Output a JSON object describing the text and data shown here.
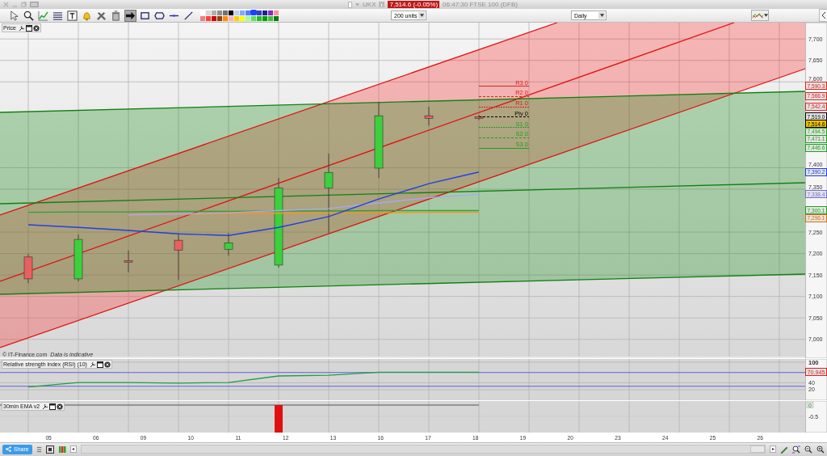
{
  "title_bar": {
    "symbol": "UKX",
    "price_badge": "7,514.6 (-0.05%)",
    "status": "06:47:30 FTSE 100 (DFB)"
  },
  "toolbar": {
    "tools": [
      {
        "kind": "pointer",
        "selected": false
      },
      {
        "kind": "zoom",
        "selected": false
      },
      {
        "kind": "chart-line",
        "selected": false
      },
      {
        "kind": "text-lines",
        "selected": false
      },
      {
        "kind": "text-box",
        "selected": false
      },
      {
        "kind": "bell",
        "selected": false
      },
      {
        "kind": "tools",
        "selected": false
      },
      {
        "kind": "trash",
        "selected": false
      },
      {
        "kind": "arrow",
        "selected": true
      },
      {
        "kind": "rectangle",
        "selected": false
      },
      {
        "kind": "ellipse",
        "selected": false
      },
      {
        "kind": "horizontal-line",
        "selected": false
      },
      {
        "kind": "trend-line",
        "selected": false
      }
    ],
    "palette": [
      {
        "color": "#ffffff",
        "selected": false
      },
      {
        "color": "#d8d8d8",
        "selected": false
      },
      {
        "color": "#b0b0b0",
        "selected": false
      },
      {
        "color": "#909090",
        "selected": false
      },
      {
        "color": "#707070",
        "selected": false
      },
      {
        "color": "#000000",
        "selected": false
      },
      {
        "color": "#b8d0ff",
        "selected": false
      },
      {
        "color": "#80a8ff",
        "selected": false
      },
      {
        "color": "#5080ff",
        "selected": false
      },
      {
        "color": "#2040ff",
        "selected": true
      },
      {
        "color": "#3040c0",
        "selected": false
      },
      {
        "color": "#202090",
        "selected": false
      },
      {
        "color": "#8030c0",
        "selected": false
      },
      {
        "color": "#ff90a0",
        "selected": false
      },
      {
        "color": "#f08080",
        "selected": false
      },
      {
        "color": "#ff4040",
        "selected": false
      },
      {
        "color": "#d00000",
        "selected": false
      },
      {
        "color": "#8b4513",
        "selected": false
      },
      {
        "color": "#ff8c00",
        "selected": false
      },
      {
        "color": "#ffb0b0",
        "selected": false
      },
      {
        "color": "#ffd000",
        "selected": false
      },
      {
        "color": "#ffff00",
        "selected": false
      },
      {
        "color": "#a0ffa0",
        "selected": false
      },
      {
        "color": "#60e060",
        "selected": false
      },
      {
        "color": "#20c020",
        "selected": false
      },
      {
        "color": "#00a000",
        "selected": false
      },
      {
        "color": "#40c040",
        "selected": false
      },
      {
        "color": "#008000",
        "selected": false
      }
    ],
    "units": "200 units",
    "period": "Daily"
  },
  "price_pane": {
    "title": "Price",
    "copyright": "© IT-Finance.com",
    "disclaimer": "Data is indicative",
    "axis_labels": [
      "7,700",
      "7,650",
      "7,600",
      "7,400",
      "7,350",
      "7,250",
      "7,200",
      "7,150",
      "7,100",
      "7,050",
      "7,000"
    ],
    "pivot_labels": [
      {
        "label": "R3 0",
        "color": "#e02020"
      },
      {
        "label": "R2 0",
        "color": "#e02020"
      },
      {
        "label": "R1 0",
        "color": "#e02020"
      },
      {
        "label": "Piv 0",
        "color": "#000000"
      },
      {
        "label": "S1 0",
        "color": "#20a020"
      },
      {
        "label": "S2 0",
        "color": "#20a020"
      },
      {
        "label": "S3 0",
        "color": "#20a020"
      }
    ],
    "price_tags": [
      {
        "label": "7,590.3",
        "color": "#e02020",
        "kind": "level"
      },
      {
        "label": "7,566.9",
        "color": "#e02020",
        "kind": "level"
      },
      {
        "label": "7,542.4",
        "color": "#e02020",
        "kind": "level"
      },
      {
        "label": "7,519.0",
        "color": "#000000",
        "kind": "level"
      },
      {
        "label": "7,514.6",
        "color": "#000000",
        "kind": "last"
      },
      {
        "label": "7,494.5",
        "color": "#20a020",
        "kind": "level"
      },
      {
        "label": "7,471.1",
        "color": "#20a020",
        "kind": "level"
      },
      {
        "label": "7,446.6",
        "color": "#20a020",
        "kind": "level"
      },
      {
        "label": "7,390.2",
        "color": "#2040e0",
        "kind": "level"
      },
      {
        "label": "7,338.4",
        "color": "#7070d8",
        "kind": "level"
      },
      {
        "label": "7,300.1",
        "color": "#20a020",
        "kind": "level"
      },
      {
        "label": "7,296.1",
        "color": "#e07010",
        "kind": "level"
      }
    ]
  },
  "rsi_pane": {
    "title": "Relative strength index (RSI) (10)",
    "axis_labels": [
      "100",
      "40",
      "20"
    ],
    "value_tag": {
      "label": "70.945",
      "color": "#e02020"
    }
  },
  "ema_pane": {
    "title": "30min EMA v2",
    "zero_label": "0",
    "axis_label": "-0.5"
  },
  "date_axis": [
    "05",
    "06",
    "09",
    "10",
    "11",
    "12",
    "13",
    "16",
    "17",
    "18",
    "19",
    "20",
    "23",
    "24",
    "25",
    "26"
  ],
  "bottom_bar": {
    "share": "Share"
  }
}
